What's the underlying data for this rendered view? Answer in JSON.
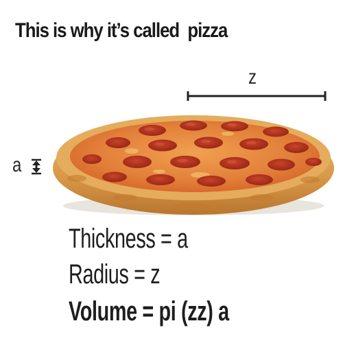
{
  "title": "This is why it’s called  pizza",
  "measure": {
    "radius_label": "z",
    "thickness_label": "a",
    "thickness_icon": "up-down-arrow-icon",
    "radius_icon": "dimension-line-icon"
  },
  "formulas": {
    "thickness": "Thickness = a",
    "radius": "Radius = z",
    "volume": "Volume = pi (zz) a"
  },
  "image": {
    "subject": "pepperoni-pizza-icon"
  },
  "colors": {
    "text": "#1e1e1e",
    "crust": "#d9a050",
    "sauce": "#d4542a",
    "cheese": "#e88a3a",
    "pepperoni": "#b8321e"
  }
}
